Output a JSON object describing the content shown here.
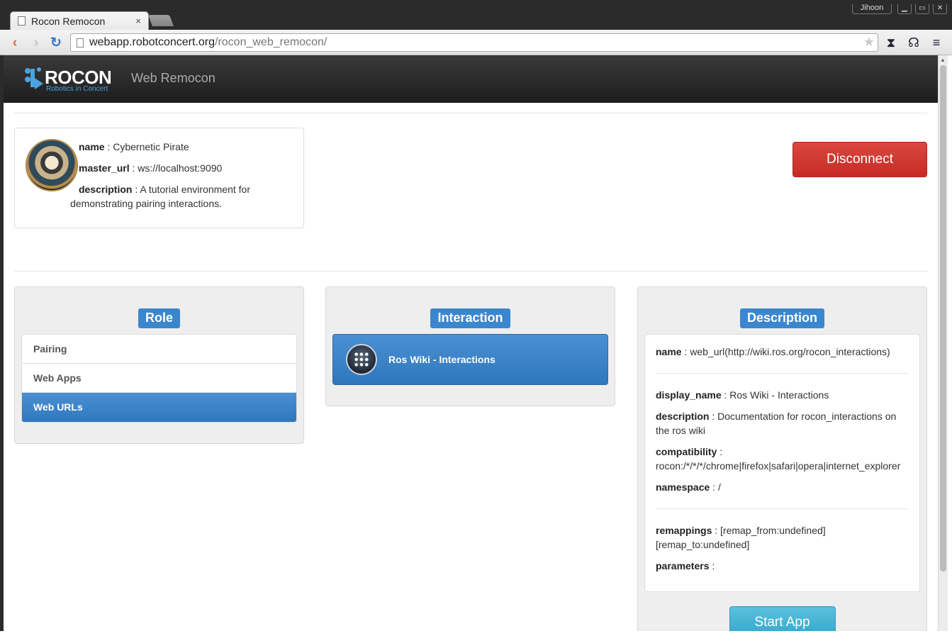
{
  "browser": {
    "tab_title": "Rocon Remocon",
    "tab_close": "×",
    "window_user": "Jihoon",
    "url_host": "webapp.robotconcert.org",
    "url_path": "/rocon_web_remocon/"
  },
  "navbar": {
    "logo_word": "ROCON",
    "logo_sub": "Robotics in Concert",
    "brand": "Web Remocon"
  },
  "concert": {
    "name_key": "name",
    "name_value": " : Cybernetic Pirate",
    "master_url_key": "master_url",
    "master_url_value": " : ws://localhost:9090",
    "description_key": "description",
    "description_value": " : A tutorial environment for demonstrating pairing interactions."
  },
  "disconnect_label": "Disconnect",
  "role_panel": {
    "title": "Role",
    "items": [
      {
        "label": "Pairing",
        "active": false
      },
      {
        "label": "Web Apps",
        "active": false
      },
      {
        "label": "Web URLs",
        "active": true
      }
    ]
  },
  "interaction_panel": {
    "title": "Interaction",
    "items": [
      {
        "label": "Ros Wiki - Interactions",
        "icon": "app-grid-icon"
      }
    ]
  },
  "description_panel": {
    "title": "Description",
    "name_key": "name",
    "name_value": " : web_url(http://wiki.ros.org/rocon_interactions)",
    "display_name_key": "display_name",
    "display_name_value": " : Ros Wiki - Interactions",
    "description_key": "description",
    "description_value": " : Documentation for rocon_interactions on the ros wiki",
    "compatibility_key": "compatibility",
    "compatibility_value": " : rocon:/*/*/*/chrome|firefox|safari|opera|internet_explorer",
    "namespace_key": "namespace",
    "namespace_value": " : /",
    "remappings_key": "remappings",
    "remappings_value": " : [remap_from:undefined] [remap_to:undefined]",
    "parameters_key": "parameters",
    "parameters_value": " :",
    "start_label": "Start App"
  },
  "colors": {
    "primary": "#3a87cf",
    "danger": "#c9302c",
    "info": "#5bc0de",
    "navbar": "#222222"
  }
}
